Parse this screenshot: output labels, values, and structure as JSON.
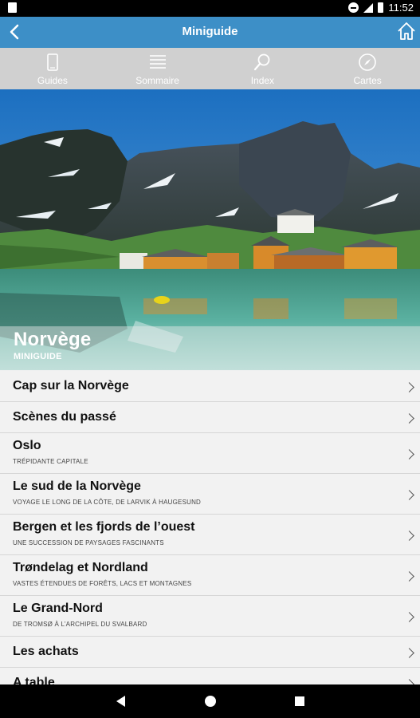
{
  "status_bar": {
    "time": "11:52"
  },
  "app_bar": {
    "title": "Miniguide"
  },
  "toolbar": [
    {
      "label": "Guides",
      "icon": "phone-icon"
    },
    {
      "label": "Sommaire",
      "icon": "list-icon"
    },
    {
      "label": "Index",
      "icon": "search-icon"
    },
    {
      "label": "Cartes",
      "icon": "compass-icon"
    }
  ],
  "hero": {
    "title": "Norvège",
    "subtitle": "MINIGUIDE"
  },
  "list": [
    {
      "title": "Cap sur la Norvège",
      "subtitle": ""
    },
    {
      "title": "Scènes du passé",
      "subtitle": ""
    },
    {
      "title": "Oslo",
      "subtitle": "Trépidante capitale"
    },
    {
      "title": "Le sud de la Norvège",
      "subtitle": "Voyage le long de la côte, de Larvik à Haugesund"
    },
    {
      "title": "Bergen et les fjords de l’ouest",
      "subtitle": "Une succession de paysages fascinants"
    },
    {
      "title": "Trøndelag et Nordland",
      "subtitle": "Vastes étendues de forêts, lacs et montagnes"
    },
    {
      "title": "Le Grand-Nord",
      "subtitle": "De Tromsø à l’archipel du Svalbard"
    },
    {
      "title": "Les achats",
      "subtitle": ""
    },
    {
      "title": "A table",
      "subtitle": ""
    }
  ],
  "colors": {
    "app_bar": "#3d8fc7",
    "toolbar": "#d0d0d0",
    "list_bg": "#f2f2f2"
  }
}
